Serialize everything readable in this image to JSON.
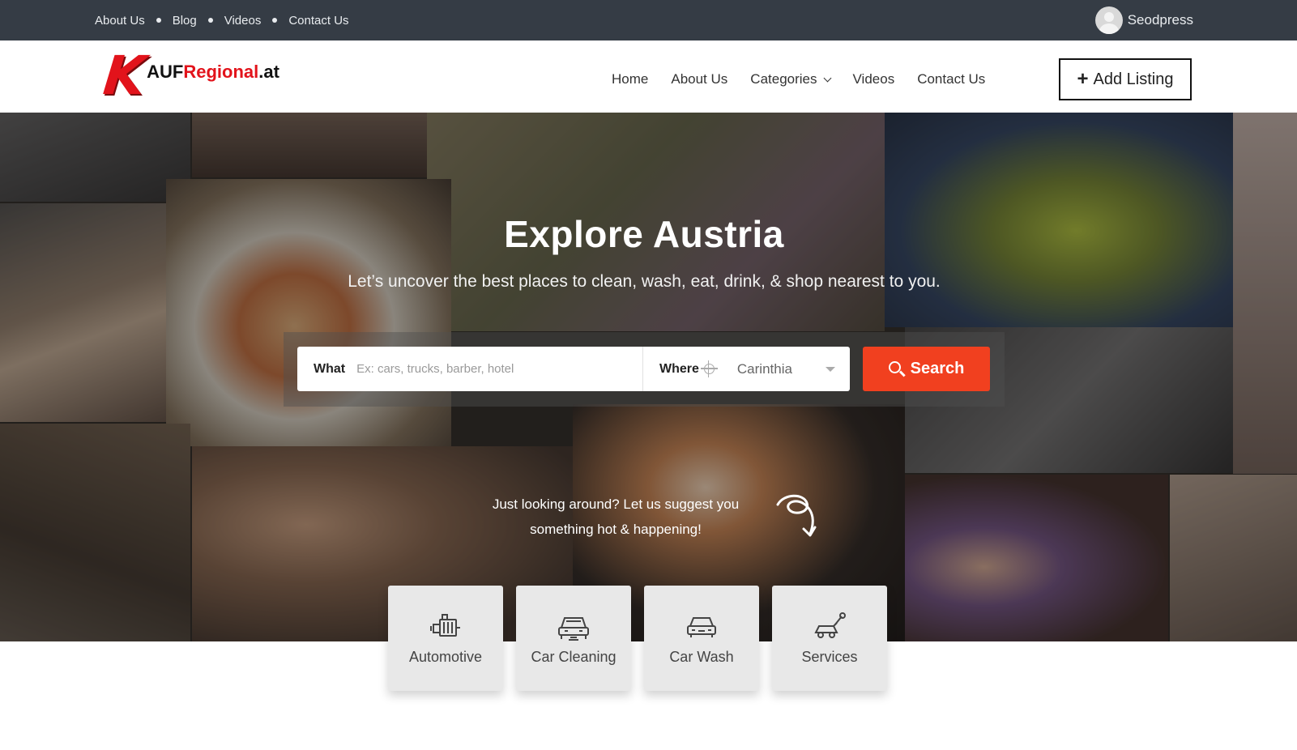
{
  "topbar": {
    "links": [
      "About Us",
      "Blog",
      "Videos",
      "Contact Us"
    ],
    "user_name": "Seodpress"
  },
  "logo": {
    "k": "K",
    "auf": "AUF",
    "regional": "Regional",
    "at": ".at"
  },
  "nav": {
    "home": "Home",
    "about": "About Us",
    "categories": "Categories",
    "videos": "Videos",
    "contact": "Contact Us",
    "add_listing": "Add Listing"
  },
  "hero": {
    "title": "Explore Austria",
    "subtitle": "Let’s uncover the best places to clean, wash, eat, drink, & shop nearest to you."
  },
  "search": {
    "what_label": "What",
    "what_placeholder": "Ex: cars, trucks, barber, hotel",
    "where_label": "Where",
    "where_value": "Carinthia",
    "button_label": "Search"
  },
  "suggest": {
    "line1": "Just looking around? Let us suggest you",
    "line2": "something hot & happening!"
  },
  "categories": [
    {
      "label": "Automotive",
      "icon": "engine-icon"
    },
    {
      "label": "Car Cleaning",
      "icon": "car-cleaning-icon"
    },
    {
      "label": "Car Wash",
      "icon": "car-wash-icon"
    },
    {
      "label": "Services",
      "icon": "services-icon"
    }
  ],
  "colors": {
    "topbar": "#353c45",
    "brand_red": "#e2131b",
    "search_button": "#f1401f"
  }
}
